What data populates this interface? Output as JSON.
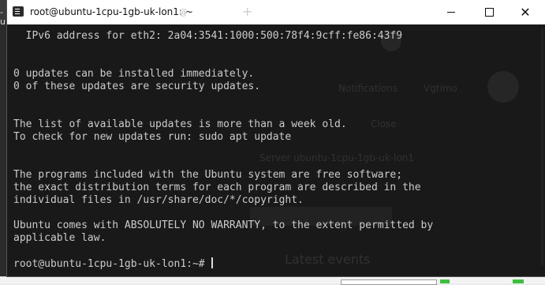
{
  "window": {
    "title": "root@ubuntu-1cpu-1gb-uk-lon1: ~",
    "ghost_tab": "@",
    "ghost_plus": "+",
    "close_glyph": "✕"
  },
  "background": {
    "left_text": "-u",
    "notifications": "Notifications",
    "user": "Vgtimo",
    "close": "Close",
    "server": "Server ubuntu-1cpu-1gb-uk-lon1",
    "events": "Latest events"
  },
  "terminal": {
    "lines": [
      "  IPv6 address for eth2: 2a04:3541:1000:500:78f4:9cff:fe86:43f9",
      "",
      "",
      "0 updates can be installed immediately.",
      "0 of these updates are security updates.",
      "",
      "",
      "The list of available updates is more than a week old.",
      "To check for new updates run: sudo apt update",
      "",
      "",
      "The programs included with the Ubuntu system are free software;",
      "the exact distribution terms for each program are described in the",
      "individual files in /usr/share/doc/*/copyright.",
      "",
      "Ubuntu comes with ABSOLUTELY NO WARRANTY, to the extent permitted by",
      "applicable law.",
      "",
      "root@ubuntu-1cpu-1gb-uk-lon1:~# "
    ]
  }
}
